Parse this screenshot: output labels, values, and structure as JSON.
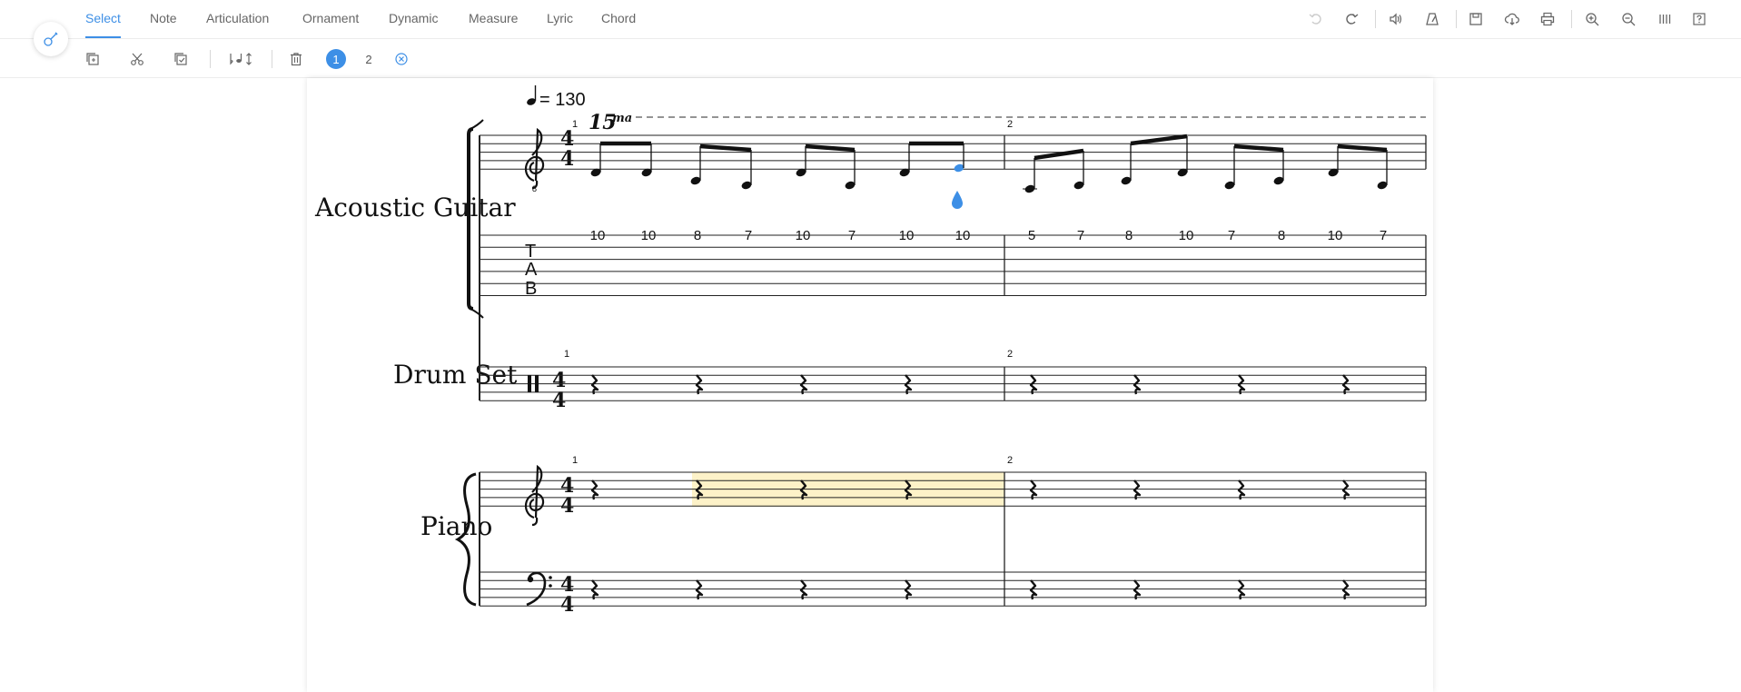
{
  "app": {
    "tabs": [
      {
        "label": "Select",
        "active": true
      },
      {
        "label": "Note",
        "active": false
      },
      {
        "label": "Articulation",
        "active": false
      },
      {
        "label": "Ornament",
        "active": false
      },
      {
        "label": "Dynamic",
        "active": false
      },
      {
        "label": "Measure",
        "active": false
      },
      {
        "label": "Lyric",
        "active": false
      },
      {
        "label": "Chord",
        "active": false
      }
    ],
    "voices": [
      "1",
      "2"
    ],
    "accent_color": "#3d8fe6",
    "selection_color": "#fdf2c8"
  },
  "score": {
    "tempo": "= 130",
    "ottava": "15",
    "ottava_suffix": "ma",
    "measure_numbers": [
      "1",
      "2"
    ],
    "instruments": [
      {
        "name": "Acoustic Guitar"
      },
      {
        "name": "Drum Set"
      },
      {
        "name": "Piano"
      }
    ],
    "tab_labels": [
      "T",
      "A",
      "B"
    ],
    "time_signature": [
      "4",
      "4"
    ],
    "guitar_tab_frets": [
      [
        "10",
        "10",
        "8",
        "7",
        "10",
        "7",
        "10",
        "10"
      ],
      [
        "5",
        "7",
        "8",
        "10",
        "7",
        "8",
        "10",
        "7"
      ]
    ]
  }
}
